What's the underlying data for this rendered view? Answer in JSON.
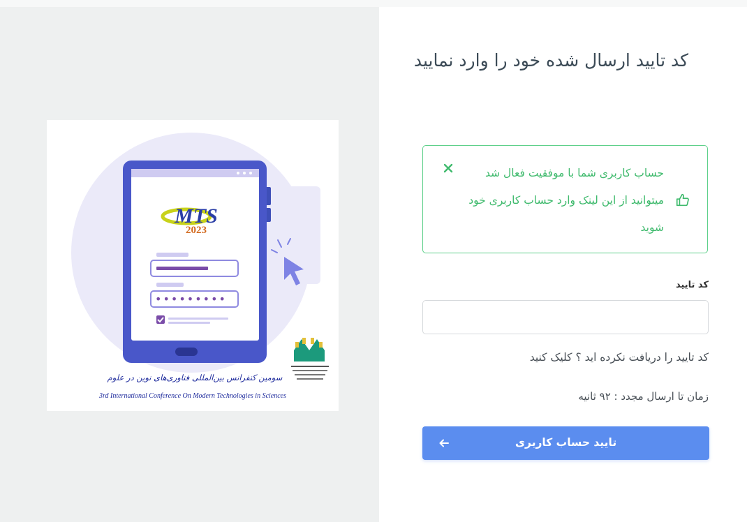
{
  "page": {
    "title": "کد تایید ارسال شده خود را وارد نمایید"
  },
  "illustration": {
    "logo_text": "MTS",
    "logo_year": "2023",
    "conference_fa": "سومین کنفرانس بین‌المللی فناوری‌های نوین در علوم",
    "conference_en": "3rd International Conference On Modern Technologies in Sciences",
    "password_mask": "•••••••••"
  },
  "alert": {
    "message": "حساب کاربری شما با موفقیت فعال شد میتوانید از این لینک وارد حساب کاربری خود شوید",
    "color": "#3fba6d"
  },
  "form": {
    "code_label": "کد تایید",
    "code_value": "",
    "resend_text": "کد تایید را دریافت نکرده اید ؟ کلیک کنید",
    "timer_text": "زمان تا ارسال مجدد : ۹۲ ثانیه",
    "submit_label": "تایید حساب کاربری"
  },
  "colors": {
    "accent": "#5b8def",
    "success": "#5ed08a",
    "left_bg": "#eef0f0"
  },
  "icons": {
    "close": "close-icon",
    "thumbs": "thumbs-up-icon",
    "arrow": "arrow-left-icon"
  }
}
